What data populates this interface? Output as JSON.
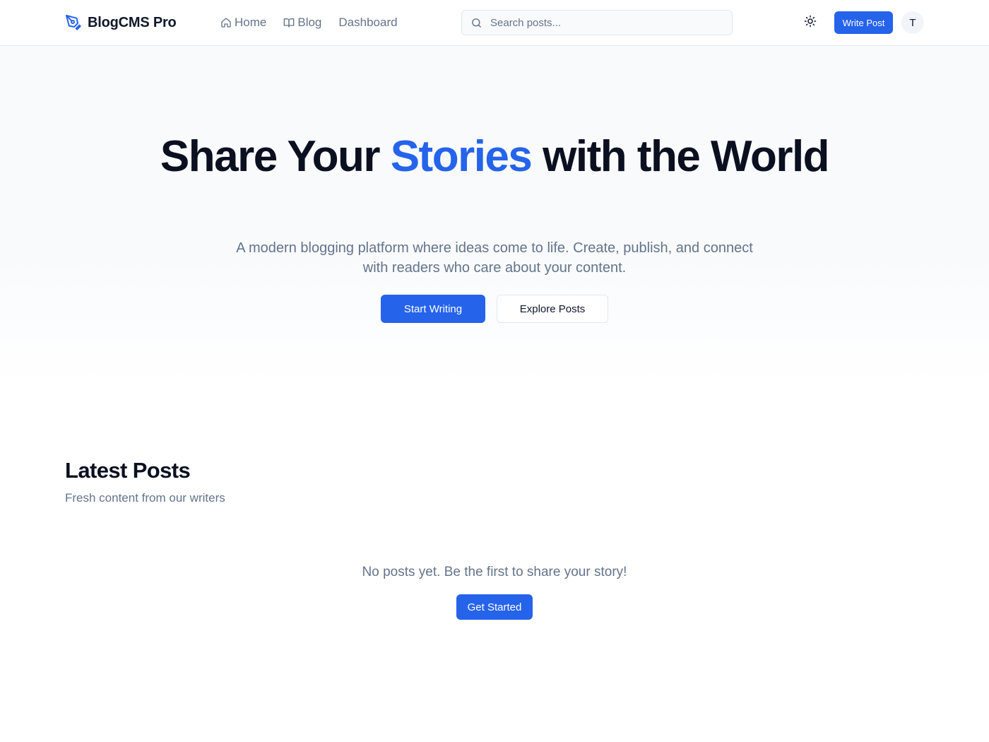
{
  "app": {
    "brand_name": "BlogCMS Pro",
    "brand_icon": "pen-tool-icon",
    "accent_color": "#2563eb"
  },
  "nav": {
    "items": [
      {
        "label": "Home",
        "icon": "home-icon"
      },
      {
        "label": "Blog",
        "icon": "book-open-icon"
      },
      {
        "label": "Dashboard",
        "icon": ""
      }
    ]
  },
  "search": {
    "placeholder": "Search posts...",
    "value": ""
  },
  "header_actions": {
    "theme_icon": "sun-icon",
    "write_label": "Write Post",
    "avatar_initial": "T"
  },
  "hero": {
    "title_part1": "Share Your",
    "title_accent": "Stories",
    "title_part2": "with the World",
    "subtitle": "A modern blogging platform where ideas come to life. Create, publish, and connect with readers who care about your content.",
    "primary_label": "Start Writing",
    "secondary_label": "Explore Posts"
  },
  "latest": {
    "title": "Latest Posts",
    "subtitle": "Fresh content from our writers",
    "empty_text": "No posts yet. Be the first to share your story!",
    "cta_label": "Get Started"
  }
}
